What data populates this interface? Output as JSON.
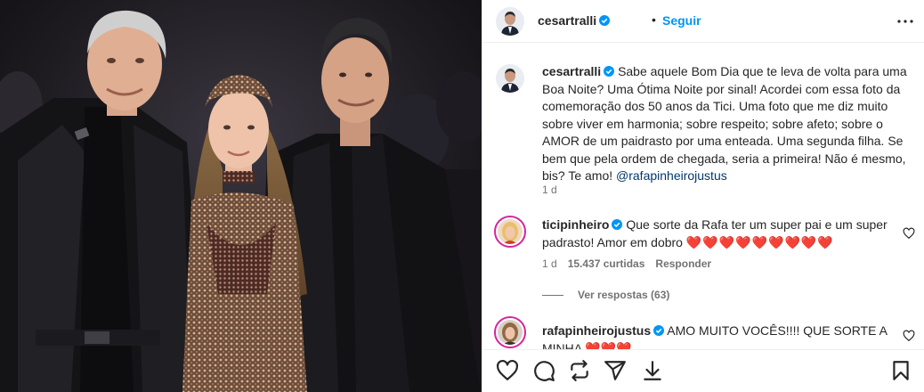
{
  "post": {
    "username": "cesartralli",
    "follow_label": "Seguir",
    "dot": "•"
  },
  "caption": {
    "username": "cesartralli",
    "text": "Sabe aquele Bom Dia que te leva de volta para uma Boa Noite? Uma Ótima Noite por sinal! Acordei com essa foto da comemoração dos 50 anos da Tici. Uma foto que me diz muito sobre viver em harmonia; sobre respeito; sobre afeto; sobre o AMOR de um paidrasto por uma enteada. Uma segunda filha. Se bem que pela ordem de chegada, seria a primeira! Não é mesmo, bis? Te amo! ",
    "mention": "@rafapinheirojustus",
    "time": "1 d"
  },
  "comments": [
    {
      "username": "ticipinheiro",
      "text": "Que sorte da Rafa ter um super pai e um super padrasto! Amor em dobro ",
      "emoji": "❤️❤️❤️❤️❤️❤️❤️❤️❤️",
      "time": "1 d",
      "likes": "15.437 curtidas",
      "reply_label": "Responder",
      "view_replies": "Ver respostas (63)"
    },
    {
      "username": "rafapinheirojustus",
      "text": "AMO MUITO VOCÊS!!!! QUE SORTE A MINHA ",
      "emoji": "❤️❤️❤️"
    }
  ],
  "icons": {
    "verified": "verified-badge-icon",
    "more": "more-options-icon",
    "like": "heart-icon",
    "comment": "comment-icon",
    "repost": "repost-icon",
    "share": "share-icon",
    "download": "download-icon",
    "save": "bookmark-icon"
  },
  "colors": {
    "link": "#0095f6",
    "mention": "#00376b",
    "muted": "#737373",
    "text": "#262626",
    "verified": "#0095f6"
  }
}
